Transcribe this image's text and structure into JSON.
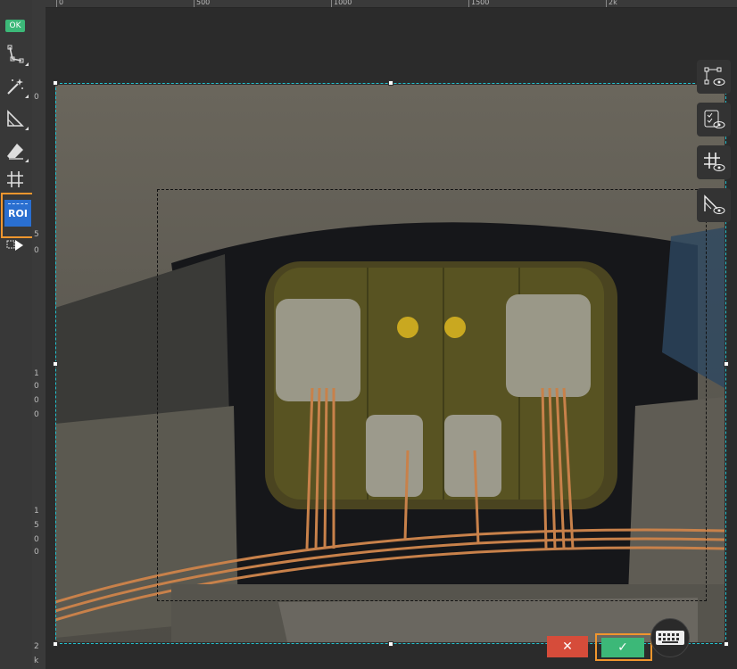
{
  "toolbar": {
    "ok_badge": "OK",
    "roi_label": "ROI",
    "tools": [
      "polygon-icon",
      "magic-wand-icon",
      "ruler-corner-icon",
      "eraser-icon",
      "grid-icon",
      "roi-icon",
      "play-arrow-icon"
    ]
  },
  "rulers": {
    "horizontal": [
      "0",
      "500",
      "1000",
      "1500",
      "2k"
    ],
    "vertical": [
      "0",
      "5",
      "0",
      "1",
      "0",
      "0",
      "0",
      "1",
      "5",
      "0",
      "0",
      "2",
      "k"
    ]
  },
  "side_buttons": [
    "polygon-eye-icon",
    "checklist-eye-icon",
    "grid-eye-icon",
    "angle-eye-icon"
  ],
  "actions": {
    "cancel": "✕",
    "confirm": "✓",
    "keyboard": "keyboard-icon"
  },
  "colors": {
    "accent_orange": "#f0962e",
    "ok_green": "#3cb878",
    "cancel_red": "#d64c3a",
    "selection": "#22c3d0",
    "roi_blue": "#2a6fd0"
  }
}
